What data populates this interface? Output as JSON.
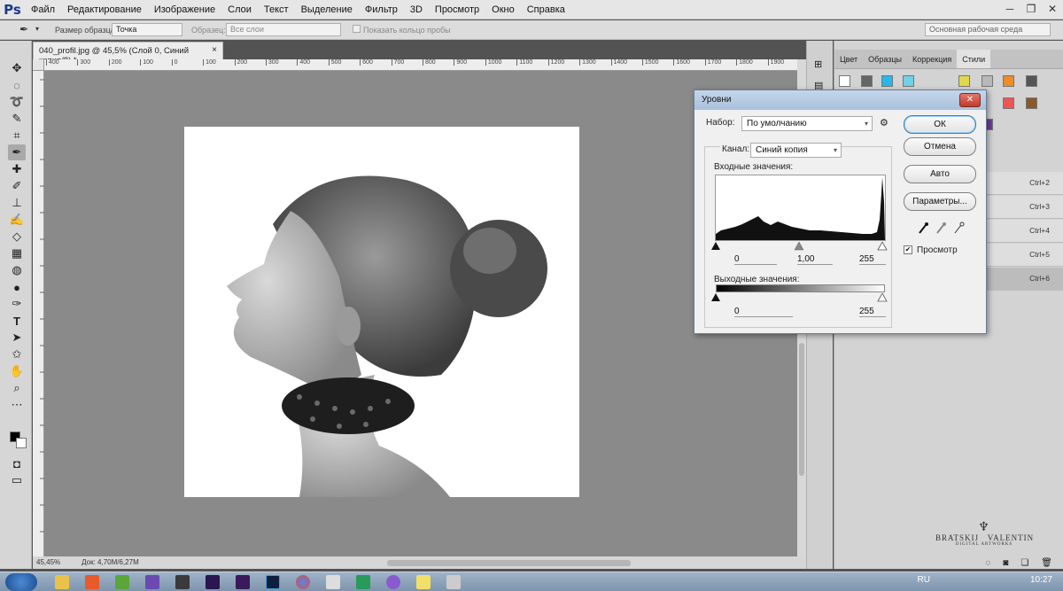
{
  "app": {
    "logo": "Ps",
    "menu": [
      "Файл",
      "Редактирование",
      "Изображение",
      "Слои",
      "Текст",
      "Выделение",
      "Фильтр",
      "3D",
      "Просмотр",
      "Окно",
      "Справка"
    ]
  },
  "options_bar": {
    "sample_size_label": "Размер образца:",
    "sample_size_value": "Точка",
    "sample_label": "Образец:",
    "sample_value": "Все слои",
    "show_ring_label": "Показать кольцо пробы",
    "workspace": "Основная рабочая среда"
  },
  "document": {
    "tab_title": "040_profil.jpg @ 45,5% (Слой 0, Синий копия/8) *",
    "ruler_ticks": [
      "400",
      "300",
      "200",
      "100",
      "0",
      "100",
      "200",
      "300",
      "400",
      "500",
      "600",
      "700",
      "800",
      "900",
      "1000",
      "1100",
      "1200",
      "1300",
      "1400",
      "1500",
      "1600",
      "1700",
      "1800",
      "1900"
    ],
    "zoom": "45,45%",
    "doc_size": "Док: 4,70M/6,27M"
  },
  "right_panel": {
    "tabs": [
      "Цвет",
      "Образцы",
      "Коррекция",
      "Стили"
    ],
    "active_tab": "Стили",
    "shortcuts": [
      "Ctrl+2",
      "Ctrl+3",
      "Ctrl+4",
      "Ctrl+5",
      "Ctrl+6"
    ]
  },
  "levels": {
    "title": "Уровни",
    "preset_label": "Набор:",
    "preset_value": "По умолчанию",
    "channel_label": "Канал:",
    "channel_value": "Синий копия",
    "input_label": "Входные значения:",
    "input_black": "0",
    "input_gamma": "1,00",
    "input_white": "255",
    "output_label": "Выходные значения:",
    "output_black": "0",
    "output_white": "255",
    "ok": "ОК",
    "cancel": "Отмена",
    "auto": "Авто",
    "options": "Параметры...",
    "preview_label": "Просмотр",
    "preview_checked": true
  },
  "watermark": {
    "name_left": "BRATSKIJ",
    "name_right": "VALENTIN",
    "subtitle": "DIGITAL ARTWORKS"
  },
  "taskbar": {
    "lang": "RU",
    "time": "10:27"
  }
}
